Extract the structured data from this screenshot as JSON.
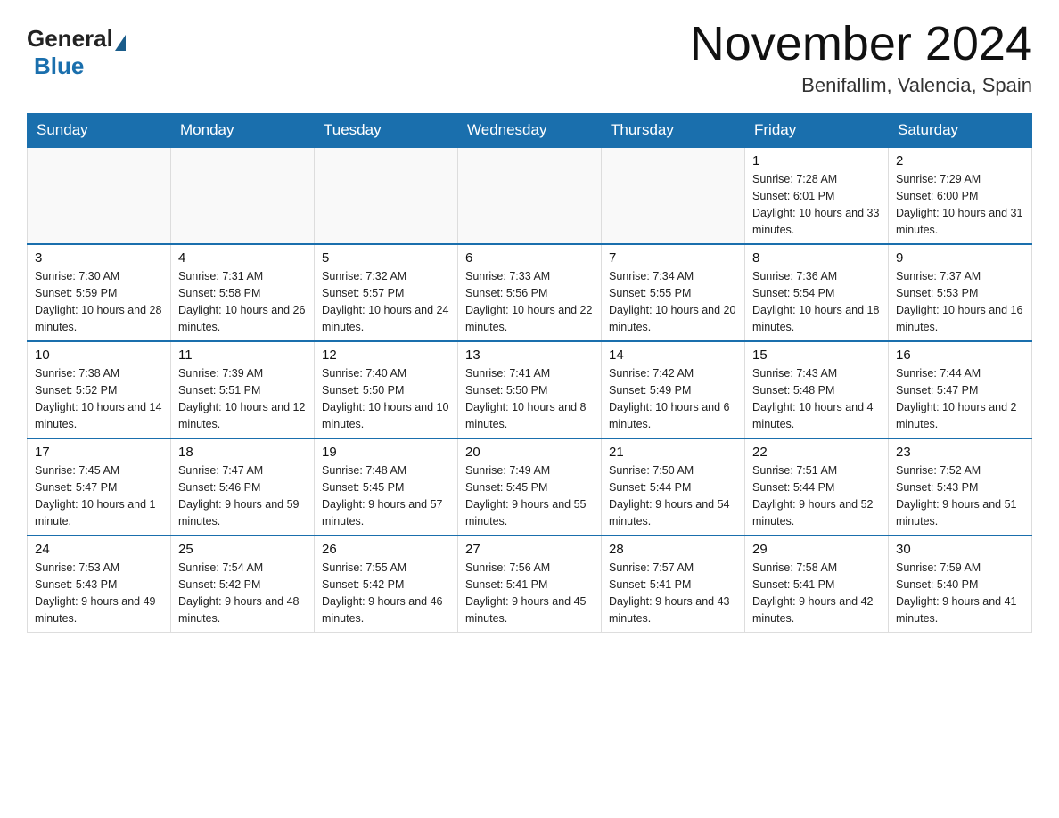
{
  "logo": {
    "general": "General",
    "blue": "Blue"
  },
  "title": "November 2024",
  "location": "Benifallim, Valencia, Spain",
  "weekdays": [
    "Sunday",
    "Monday",
    "Tuesday",
    "Wednesday",
    "Thursday",
    "Friday",
    "Saturday"
  ],
  "weeks": [
    [
      {
        "day": "",
        "info": ""
      },
      {
        "day": "",
        "info": ""
      },
      {
        "day": "",
        "info": ""
      },
      {
        "day": "",
        "info": ""
      },
      {
        "day": "",
        "info": ""
      },
      {
        "day": "1",
        "info": "Sunrise: 7:28 AM\nSunset: 6:01 PM\nDaylight: 10 hours and 33 minutes."
      },
      {
        "day": "2",
        "info": "Sunrise: 7:29 AM\nSunset: 6:00 PM\nDaylight: 10 hours and 31 minutes."
      }
    ],
    [
      {
        "day": "3",
        "info": "Sunrise: 7:30 AM\nSunset: 5:59 PM\nDaylight: 10 hours and 28 minutes."
      },
      {
        "day": "4",
        "info": "Sunrise: 7:31 AM\nSunset: 5:58 PM\nDaylight: 10 hours and 26 minutes."
      },
      {
        "day": "5",
        "info": "Sunrise: 7:32 AM\nSunset: 5:57 PM\nDaylight: 10 hours and 24 minutes."
      },
      {
        "day": "6",
        "info": "Sunrise: 7:33 AM\nSunset: 5:56 PM\nDaylight: 10 hours and 22 minutes."
      },
      {
        "day": "7",
        "info": "Sunrise: 7:34 AM\nSunset: 5:55 PM\nDaylight: 10 hours and 20 minutes."
      },
      {
        "day": "8",
        "info": "Sunrise: 7:36 AM\nSunset: 5:54 PM\nDaylight: 10 hours and 18 minutes."
      },
      {
        "day": "9",
        "info": "Sunrise: 7:37 AM\nSunset: 5:53 PM\nDaylight: 10 hours and 16 minutes."
      }
    ],
    [
      {
        "day": "10",
        "info": "Sunrise: 7:38 AM\nSunset: 5:52 PM\nDaylight: 10 hours and 14 minutes."
      },
      {
        "day": "11",
        "info": "Sunrise: 7:39 AM\nSunset: 5:51 PM\nDaylight: 10 hours and 12 minutes."
      },
      {
        "day": "12",
        "info": "Sunrise: 7:40 AM\nSunset: 5:50 PM\nDaylight: 10 hours and 10 minutes."
      },
      {
        "day": "13",
        "info": "Sunrise: 7:41 AM\nSunset: 5:50 PM\nDaylight: 10 hours and 8 minutes."
      },
      {
        "day": "14",
        "info": "Sunrise: 7:42 AM\nSunset: 5:49 PM\nDaylight: 10 hours and 6 minutes."
      },
      {
        "day": "15",
        "info": "Sunrise: 7:43 AM\nSunset: 5:48 PM\nDaylight: 10 hours and 4 minutes."
      },
      {
        "day": "16",
        "info": "Sunrise: 7:44 AM\nSunset: 5:47 PM\nDaylight: 10 hours and 2 minutes."
      }
    ],
    [
      {
        "day": "17",
        "info": "Sunrise: 7:45 AM\nSunset: 5:47 PM\nDaylight: 10 hours and 1 minute."
      },
      {
        "day": "18",
        "info": "Sunrise: 7:47 AM\nSunset: 5:46 PM\nDaylight: 9 hours and 59 minutes."
      },
      {
        "day": "19",
        "info": "Sunrise: 7:48 AM\nSunset: 5:45 PM\nDaylight: 9 hours and 57 minutes."
      },
      {
        "day": "20",
        "info": "Sunrise: 7:49 AM\nSunset: 5:45 PM\nDaylight: 9 hours and 55 minutes."
      },
      {
        "day": "21",
        "info": "Sunrise: 7:50 AM\nSunset: 5:44 PM\nDaylight: 9 hours and 54 minutes."
      },
      {
        "day": "22",
        "info": "Sunrise: 7:51 AM\nSunset: 5:44 PM\nDaylight: 9 hours and 52 minutes."
      },
      {
        "day": "23",
        "info": "Sunrise: 7:52 AM\nSunset: 5:43 PM\nDaylight: 9 hours and 51 minutes."
      }
    ],
    [
      {
        "day": "24",
        "info": "Sunrise: 7:53 AM\nSunset: 5:43 PM\nDaylight: 9 hours and 49 minutes."
      },
      {
        "day": "25",
        "info": "Sunrise: 7:54 AM\nSunset: 5:42 PM\nDaylight: 9 hours and 48 minutes."
      },
      {
        "day": "26",
        "info": "Sunrise: 7:55 AM\nSunset: 5:42 PM\nDaylight: 9 hours and 46 minutes."
      },
      {
        "day": "27",
        "info": "Sunrise: 7:56 AM\nSunset: 5:41 PM\nDaylight: 9 hours and 45 minutes."
      },
      {
        "day": "28",
        "info": "Sunrise: 7:57 AM\nSunset: 5:41 PM\nDaylight: 9 hours and 43 minutes."
      },
      {
        "day": "29",
        "info": "Sunrise: 7:58 AM\nSunset: 5:41 PM\nDaylight: 9 hours and 42 minutes."
      },
      {
        "day": "30",
        "info": "Sunrise: 7:59 AM\nSunset: 5:40 PM\nDaylight: 9 hours and 41 minutes."
      }
    ]
  ]
}
